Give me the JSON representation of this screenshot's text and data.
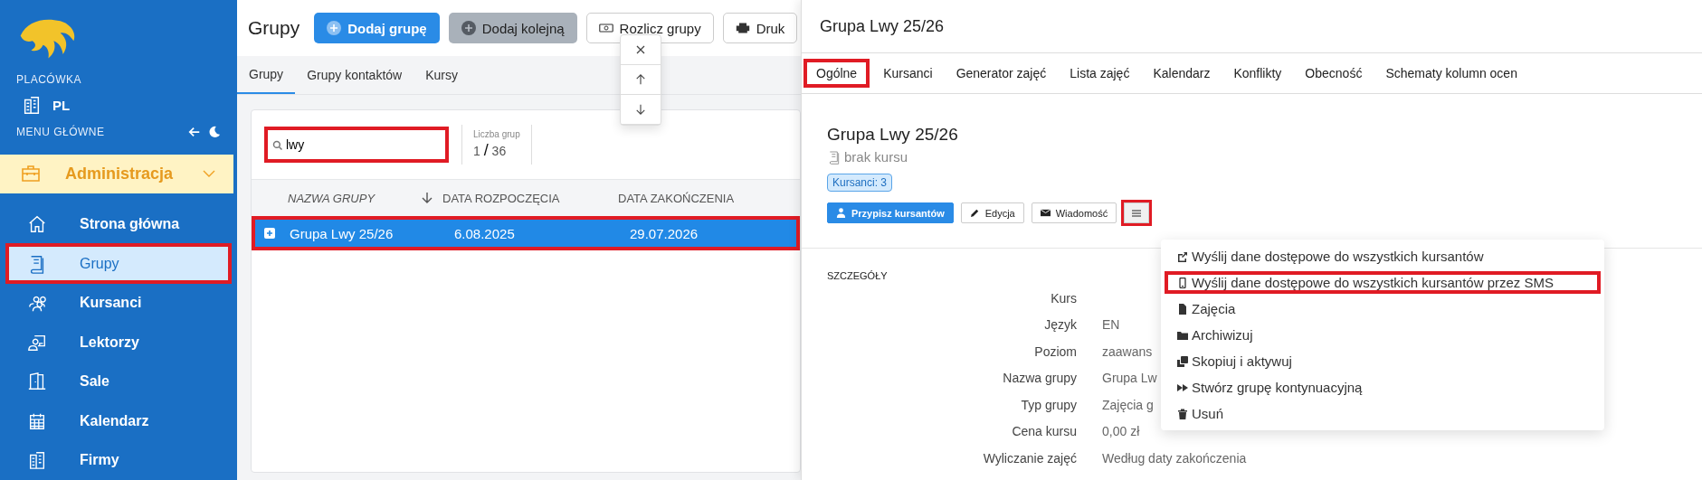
{
  "sidebar": {
    "branch_label": "PLACÓWKA",
    "branch": "PL",
    "menu_label": "MENU GŁÓWNE",
    "group": {
      "label": "Administracja",
      "expanded": true
    },
    "items": [
      {
        "label": "Strona główna",
        "selected": false,
        "highlighted": false
      },
      {
        "label": "Grupy",
        "selected": true,
        "highlighted": true
      },
      {
        "label": "Kursanci",
        "selected": false,
        "highlighted": false
      },
      {
        "label": "Lektorzy",
        "selected": false,
        "highlighted": false
      },
      {
        "label": "Sale",
        "selected": false,
        "highlighted": false
      },
      {
        "label": "Kalendarz",
        "selected": false,
        "highlighted": false
      },
      {
        "label": "Firmy",
        "selected": false,
        "highlighted": false
      }
    ]
  },
  "main": {
    "title": "Grupy",
    "actions": [
      {
        "label": "Dodaj grupę",
        "kind": "primary"
      },
      {
        "label": "Dodaj kolejną",
        "kind": "secondary"
      },
      {
        "label": "Rozlicz grupy",
        "kind": "outline"
      },
      {
        "label": "Druk",
        "kind": "outline"
      }
    ],
    "tabs": [
      {
        "label": "Grupy",
        "selected": true
      },
      {
        "label": "Grupy kontaktów",
        "selected": false
      },
      {
        "label": "Kursy",
        "selected": false
      }
    ],
    "search": {
      "value": "lwy",
      "highlighted": true
    },
    "count": {
      "label": "Liczba grup",
      "shown": "1",
      "separator": "/",
      "total": "36"
    },
    "table": {
      "columns": [
        "NAZWA GRUPY",
        "DATA ROZPOCZĘCIA",
        "DATA ZAKOŃCZENIA"
      ],
      "rows": [
        {
          "cells": [
            "Grupa Lwy 25/26",
            "6.08.2025",
            "29.07.2026"
          ],
          "selected": true,
          "highlighted": true
        }
      ]
    }
  },
  "detail": {
    "title": "Grupa Lwy 25/26",
    "tabs": [
      {
        "label": "Ogólne",
        "highlighted": true
      },
      {
        "label": "Kursanci",
        "highlighted": false
      },
      {
        "label": "Generator zajęć",
        "highlighted": false
      },
      {
        "label": "Lista zajęć",
        "highlighted": false
      },
      {
        "label": "Kalendarz",
        "highlighted": false
      },
      {
        "label": "Konflikty",
        "highlighted": false
      },
      {
        "label": "Obecność",
        "highlighted": false
      },
      {
        "label": "Schematy kolumn ocen",
        "highlighted": false
      }
    ],
    "heading": "Grupa Lwy 25/26",
    "course": "brak kursu",
    "badge": "Kursanci: 3",
    "buttons": [
      {
        "label": "Przypisz kursantów",
        "kind": "primary"
      },
      {
        "label": "Edycja",
        "kind": "outline"
      },
      {
        "label": "Wiadomość",
        "kind": "outline"
      }
    ],
    "menu_button": {
      "highlighted": true
    },
    "section": "SZCZEGÓŁY",
    "fields": [
      {
        "label": "Kurs"
      },
      {
        "label": "Język",
        "value": "EN"
      },
      {
        "label": "Poziom",
        "value": "zaawans"
      },
      {
        "label": "Nazwa grupy",
        "value": "Grupa Lw"
      },
      {
        "label": "Typ grupy",
        "value": "Zajęcia g"
      },
      {
        "label": "Cena kursu",
        "value": "0,00 zł"
      },
      {
        "label": "Wyliczanie zajęć",
        "value": "Według daty zakończenia"
      }
    ],
    "menu": {
      "items": [
        {
          "label": "Wyślij dane dostępowe do wszystkich kursantów",
          "highlighted": false
        },
        {
          "label": "Wyślij dane dostępowe do wszystkich kursantów przez SMS",
          "highlighted": true
        },
        {
          "label": "Zajęcia",
          "highlighted": false
        },
        {
          "label": "Archiwizuj",
          "highlighted": false
        },
        {
          "label": "Skopiuj i aktywuj",
          "highlighted": false
        },
        {
          "label": "Stwórz grupę kontynuacyjną",
          "highlighted": false
        },
        {
          "label": "Usuń",
          "highlighted": false
        }
      ]
    }
  }
}
